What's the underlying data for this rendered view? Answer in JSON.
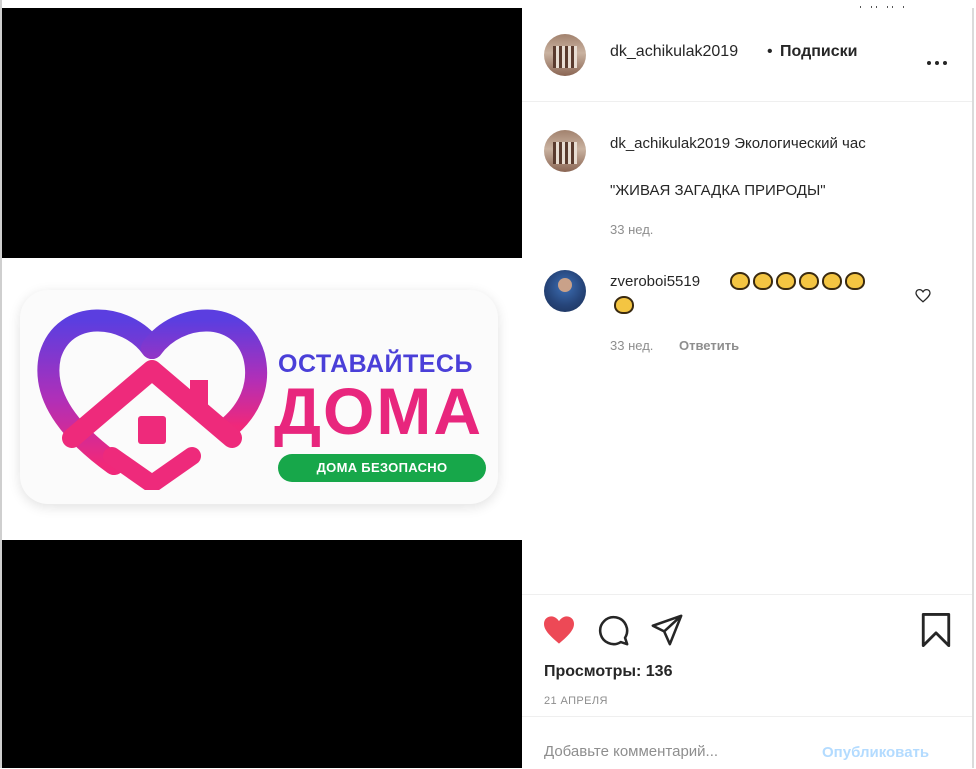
{
  "post": {
    "author": "dk_achikulak2019",
    "dot": "•",
    "follow_label": "Подписки",
    "media": {
      "line1": "ОСТАВАЙТЕСЬ",
      "line2": "ДОМА",
      "pill": "ДОМА БЕЗОПАСНО"
    }
  },
  "caption": {
    "username": "dk_achikulak2019",
    "text": "Экологический час",
    "text2": "\"ЖИВАЯ ЗАГАДКА ПРИРОДЫ\"",
    "time": "33 нед."
  },
  "comments": [
    {
      "username": "zveroboi5519",
      "time": "33 нед.",
      "reply_label": "Ответить",
      "emoji_count": 7
    }
  ],
  "actions": {
    "liked": true,
    "like_color": "#ed4956",
    "views": "Просмотры: 136",
    "date": "21 АПРЕЛЯ"
  },
  "add_comment": {
    "placeholder": "Добавьте комментарий...",
    "publish_label": "Опубликовать",
    "publish_color": "#b3dbff"
  }
}
